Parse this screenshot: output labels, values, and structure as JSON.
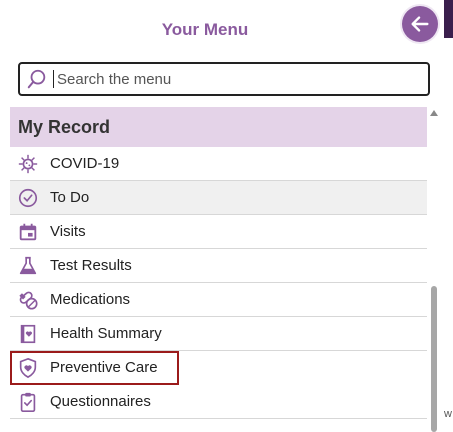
{
  "header": {
    "title": "Your Menu",
    "back_icon": "arrow-left-icon"
  },
  "search": {
    "placeholder": "Search the menu",
    "value": "",
    "icon": "search-icon"
  },
  "section": {
    "title": "My Record"
  },
  "items": [
    {
      "label": "COVID-19",
      "icon": "virus-icon"
    },
    {
      "label": "To Do",
      "icon": "clock-check-icon"
    },
    {
      "label": "Visits",
      "icon": "calendar-icon"
    },
    {
      "label": "Test Results",
      "icon": "flask-icon"
    },
    {
      "label": "Medications",
      "icon": "pill-icon"
    },
    {
      "label": "Health Summary",
      "icon": "heart-document-icon"
    },
    {
      "label": "Preventive Care",
      "icon": "shield-heart-icon"
    },
    {
      "label": "Questionnaires",
      "icon": "clipboard-check-icon"
    }
  ],
  "colors": {
    "accent": "#8a5a9e",
    "section_bg": "#e4d3e8",
    "focus": "#9b1b1b"
  }
}
